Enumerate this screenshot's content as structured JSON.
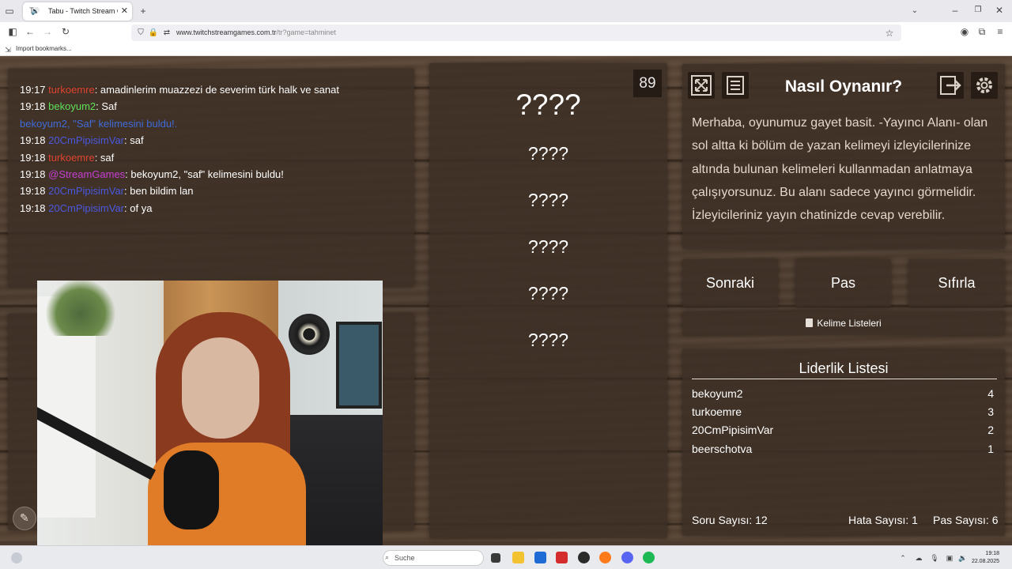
{
  "browser": {
    "tab_title": "Tabu - Twitch Stream Games",
    "tab_favicon": "T",
    "url_host": "www.twitchstreamgames.com.tr",
    "url_path": "/tr?game=tahminet",
    "bookmark_label": "Import bookmarks..."
  },
  "chat": {
    "messages": [
      {
        "time": "19:17",
        "user": "turkoemre",
        "text": ": amadinlerim muazzezi de severim türk halk ve sanat",
        "color": "#e0432f"
      },
      {
        "time": "19:18",
        "user": "bekoyum2",
        "text": ": Saf",
        "color": "#5fe05a"
      },
      {
        "time": "",
        "user": "",
        "text": "bekoyum2, \"Saf\" kelimesini buldu!.",
        "color": "#3f6ad8"
      },
      {
        "time": "19:18",
        "user": "20CmPipisimVar",
        "text": ": saf",
        "color": "#4a58e0"
      },
      {
        "time": "19:18",
        "user": "turkoemre",
        "text": ": saf",
        "color": "#e0432f"
      },
      {
        "time": "19:18",
        "user": "@StreamGames",
        "text": ": bekoyum2, \"saf\" kelimesini buldu!",
        "color": "#c93dd6"
      },
      {
        "time": "19:18",
        "user": "20CmPipisimVar",
        "text": ": ben bildim lan",
        "color": "#4a58e0"
      },
      {
        "time": "19:18",
        "user": "20CmPipisimVar",
        "text": ": of ya",
        "color": "#4a58e0"
      }
    ]
  },
  "game": {
    "timer": "89",
    "main_word": "????",
    "forbidden": [
      "????",
      "????",
      "????",
      "????",
      "????"
    ]
  },
  "howto": {
    "title": "Nasıl Oynanır?",
    "text": "Merhaba, oyunumuz gayet basit. -Yayıncı Alanı- olan sol altta ki bölüm de yazan kelimeyi izleyicilerinize altında bulunan kelimeleri kullanmadan anlatmaya çalışıyorsunuz. Bu alanı sadece yayıncı görmelidir. İzleyicileriniz yayın chatinizde cevap verebilir."
  },
  "actions": {
    "next": "Sonraki",
    "pass": "Pas",
    "reset": "Sıfırla",
    "word_lists": "Kelime Listeleri"
  },
  "leaderboard": {
    "title": "Liderlik Listesi",
    "rows": [
      {
        "name": "bekoyum2",
        "score": "4"
      },
      {
        "name": "turkoemre",
        "score": "3"
      },
      {
        "name": "20CmPipisimVar",
        "score": "2"
      },
      {
        "name": "beerschotva",
        "score": "1"
      }
    ],
    "questions": "Soru Sayısı: 12",
    "errors": "Hata Sayısı: 1",
    "passes": "Pas Sayısı: 6"
  },
  "taskbar": {
    "search_placeholder": "Suche",
    "time": "19:18",
    "date": "22.08.2025"
  },
  "icons": {
    "fullscreen": "fullscreen-icon",
    "notes": "notes-icon",
    "logout": "logout-icon",
    "settings": "gear-icon",
    "word_lists": "clipboard-icon"
  }
}
